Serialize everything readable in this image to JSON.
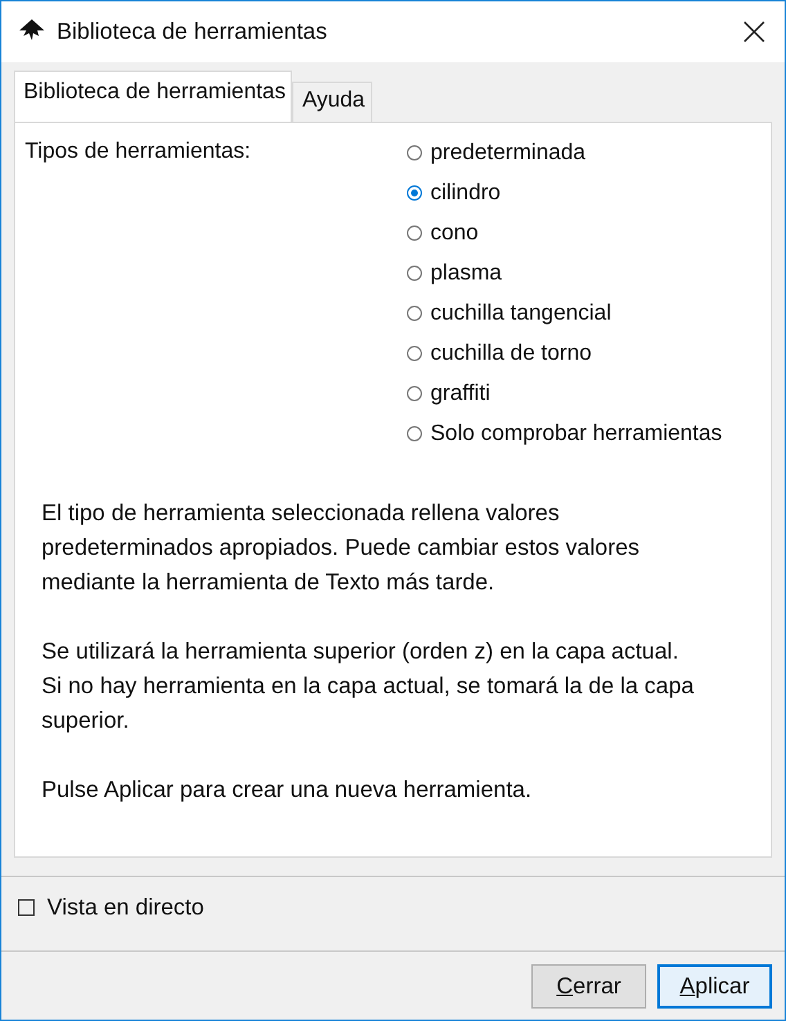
{
  "window": {
    "title": "Biblioteca de herramientas"
  },
  "tabs": [
    {
      "label": "Biblioteca de herramientas",
      "selected": true
    },
    {
      "label": "Ayuda",
      "selected": false
    }
  ],
  "tool_types": {
    "label": "Tipos de herramientas:",
    "options": [
      {
        "label": "predeterminada",
        "selected": false
      },
      {
        "label": "cilindro",
        "selected": true
      },
      {
        "label": "cono",
        "selected": false
      },
      {
        "label": "plasma",
        "selected": false
      },
      {
        "label": "cuchilla tangencial",
        "selected": false
      },
      {
        "label": "cuchilla de torno",
        "selected": false
      },
      {
        "label": "graffiti",
        "selected": false
      },
      {
        "label": "Solo comprobar herramientas",
        "selected": false
      }
    ]
  },
  "paragraphs": [
    [
      "El tipo de herramienta seleccionada rellena valores",
      "predeterminados apropiados. Puede cambiar estos valores",
      "mediante la herramienta de Texto más tarde."
    ],
    [
      "Se utilizará la herramienta superior (orden z) en la capa actual.",
      "Si no hay herramienta en la capa actual, se tomará la de la capa",
      "superior."
    ],
    [
      "Pulse Aplicar para crear una nueva herramienta."
    ]
  ],
  "live_preview": {
    "label": "Vista en directo",
    "checked": false
  },
  "buttons": [
    {
      "label": "Cerrar",
      "default": false
    },
    {
      "label": "Aplicar",
      "default": true
    }
  ]
}
